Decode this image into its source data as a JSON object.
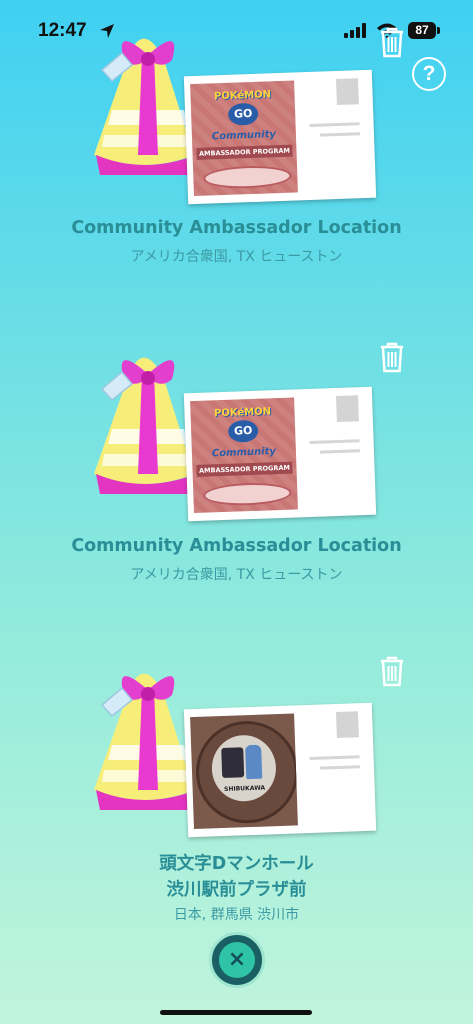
{
  "status_bar": {
    "time": "12:47",
    "battery": "87"
  },
  "header": {
    "help_label": "?"
  },
  "gifts": [
    {
      "title": "Community Ambassador Location",
      "subtitle": "アメリカ合衆国, TX ヒューストン",
      "photo_logo_top": "POKéMON",
      "photo_logo_go": "GO",
      "photo_logo_community": "Community",
      "photo_logo_program": "AMBASSADOR PROGRAM"
    },
    {
      "title": "Community Ambassador Location",
      "subtitle": "アメリカ合衆国, TX ヒューストン",
      "photo_logo_top": "POKéMON",
      "photo_logo_go": "GO",
      "photo_logo_community": "Community",
      "photo_logo_program": "AMBASSADOR PROGRAM"
    },
    {
      "title_line1": "頭文字Dマンホール",
      "title_line2": "渋川駅前プラザ前",
      "subtitle": "日本, 群馬県 渋川市",
      "photo_caption": "SHIBUKAWA"
    }
  ],
  "close_button": {
    "label": "×"
  }
}
